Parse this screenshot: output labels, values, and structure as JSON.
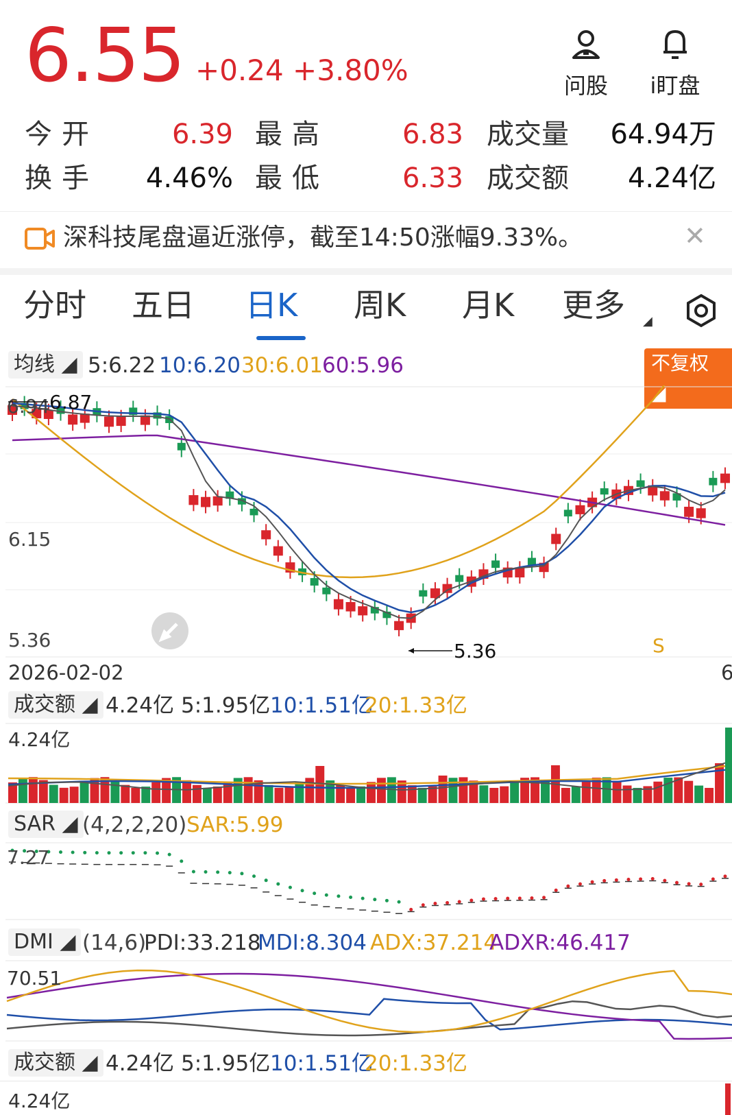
{
  "quote": {
    "price": "6.55",
    "change": "+0.24 +3.80%",
    "ask_label": "问股",
    "watch_label": "i盯盘",
    "stats": [
      {
        "label": "今开",
        "value": "6.39"
      },
      {
        "label": "最高",
        "value": "6.83"
      },
      {
        "label": "成交量",
        "value": "64.94万"
      },
      {
        "label": "换手",
        "value": "4.46%"
      },
      {
        "label": "最低",
        "value": "6.33"
      },
      {
        "label": "成交额",
        "value": "4.24亿"
      }
    ]
  },
  "notice": {
    "text": "深科技尾盘逼近涨停，截至14:50涨幅9.33%。",
    "close": "✕"
  },
  "tabs": [
    {
      "label": "分时"
    },
    {
      "label": "五日"
    },
    {
      "label": "日K"
    },
    {
      "label": "周K"
    },
    {
      "label": "月K"
    },
    {
      "label": "更多"
    }
  ],
  "ma_bar": {
    "label": "均线",
    "ma5": "5:6.22",
    "ma10": "10:6.20",
    "ma30": "30:6.01",
    "ma60": "60:5.96",
    "adjust": "不复权"
  },
  "kchart": {
    "axis_top": "6.94",
    "axis_mid": "6.15",
    "axis_low": "5.36",
    "high_mark": "6.87",
    "low_mark": "5.36",
    "date": "2026-02-02",
    "s_mark": "S",
    "right_edge": "6"
  },
  "amount_bar": {
    "label": "成交额",
    "value": "4.24亿",
    "ma5": "5:1.95亿",
    "ma10": "10:1.51亿",
    "ma20": "20:1.33亿",
    "axis": "4.24亿"
  },
  "sar_bar": {
    "label": "SAR",
    "params": "(4,2,2,20)",
    "value": "SAR:5.99",
    "axis": "7.27"
  },
  "dmi_bar": {
    "label": "DMI",
    "params": "(14,6)",
    "pdi": "PDI:33.218",
    "mdi": "MDI:8.304",
    "adx": "ADX:37.214",
    "adxr": "ADXR:46.417",
    "axis": "70.51"
  },
  "amount_bar2": {
    "label": "成交额",
    "value": "4.24亿",
    "ma5": "5:1.95亿",
    "ma10": "10:1.51亿",
    "ma20": "20:1.33亿",
    "axis": "4.24亿"
  },
  "colors": {
    "up": "#d9262c",
    "down": "#1a9a55",
    "ma5": "#555555",
    "ma10": "#1f4fa8",
    "ma30": "#e0a21b",
    "ma60": "#7d1fa0",
    "accent": "#1a64c8"
  }
}
